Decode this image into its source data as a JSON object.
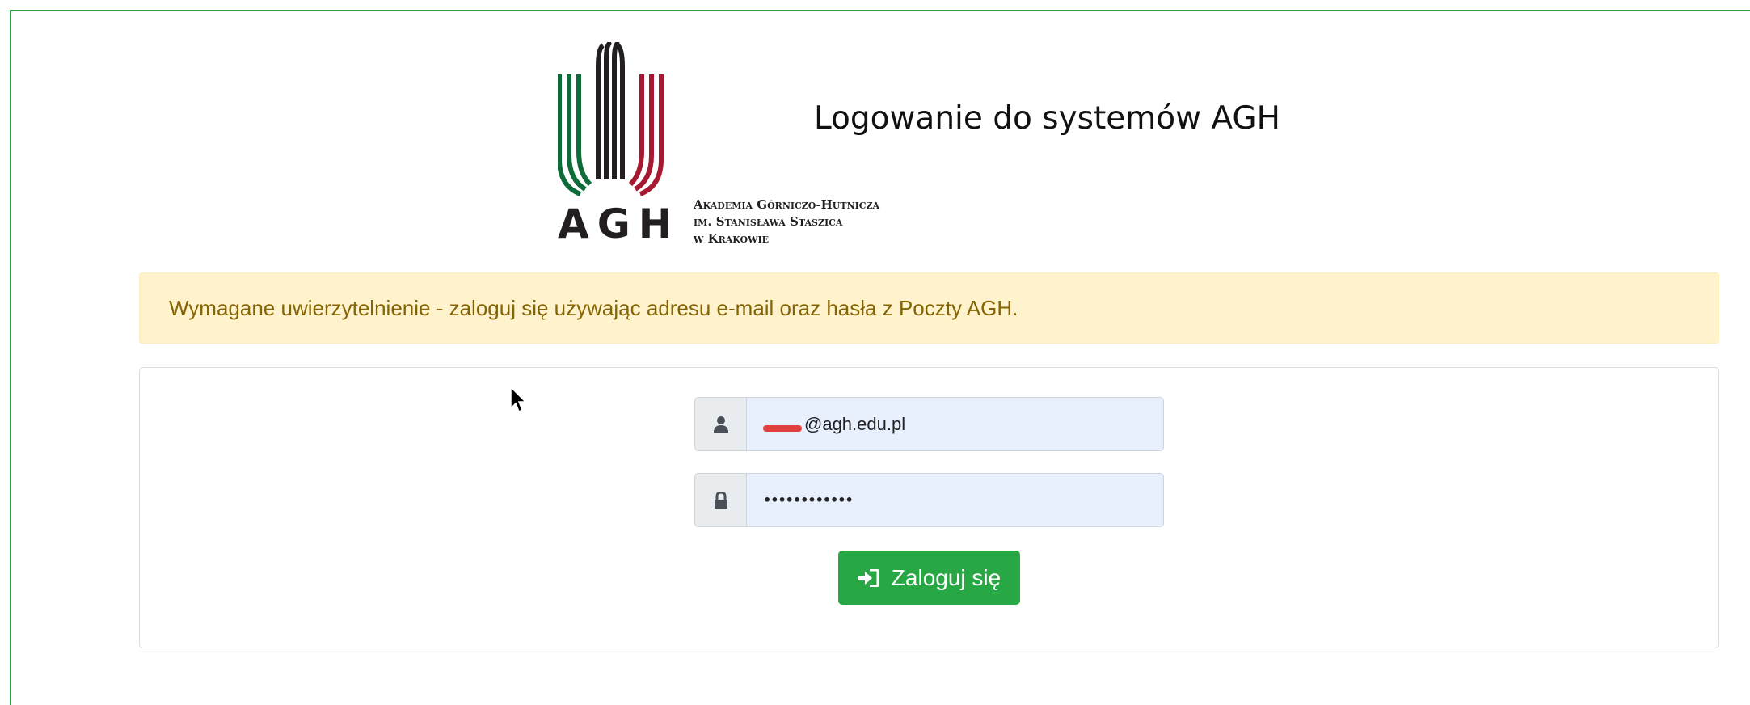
{
  "header": {
    "logo": {
      "letters": "AGH",
      "subtitle_lines": [
        "Akademia Górniczo-Hutnicza",
        "im. Stanisława Staszica",
        "w Krakowie"
      ]
    },
    "title": "Logowanie do systemów AGH"
  },
  "alert": {
    "message": "Wymagane uwierzytelnienie - zaloguj się używając adresu e-mail oraz hasła z Poczty AGH.",
    "colors": {
      "background": "#fff3cd",
      "text": "#856404"
    }
  },
  "login_form": {
    "username": {
      "icon": "user-icon",
      "value_suffix": "@agh.edu.pl"
    },
    "password": {
      "icon": "lock-icon",
      "masked_value": "••••••••••••"
    },
    "submit": {
      "icon": "sign-in-icon",
      "label": "Zaloguj się",
      "color": "#28a745"
    }
  },
  "colors": {
    "accent": "#28a745",
    "input_background": "#e8f0fe"
  }
}
